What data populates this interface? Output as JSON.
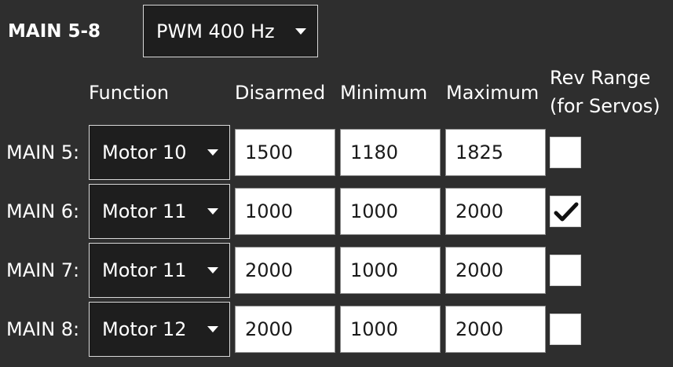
{
  "group": {
    "title": "MAIN 5-8",
    "pwm_rate": "PWM 400 Hz"
  },
  "columns": {
    "function": "Function",
    "disarmed": "Disarmed",
    "minimum": "Minimum",
    "maximum": "Maximum",
    "rev_range_line1": "Rev Range",
    "rev_range_line2": "(for Servos)"
  },
  "rows": [
    {
      "label": "MAIN 5:",
      "function": "Motor 10",
      "disarmed": "1500",
      "minimum": "1180",
      "maximum": "1825",
      "rev_range": false
    },
    {
      "label": "MAIN 6:",
      "function": "Motor 11",
      "disarmed": "1000",
      "minimum": "1000",
      "maximum": "2000",
      "rev_range": true
    },
    {
      "label": "MAIN 7:",
      "function": "Motor 11",
      "disarmed": "2000",
      "minimum": "1000",
      "maximum": "2000",
      "rev_range": false
    },
    {
      "label": "MAIN 8:",
      "function": "Motor 12",
      "disarmed": "2000",
      "minimum": "1000",
      "maximum": "2000",
      "rev_range": false
    }
  ],
  "colors": {
    "background": "#2e2e2e",
    "dropdown_background": "#1e1e1e",
    "input_background": "#ffffff"
  },
  "icons": {
    "dropdown": "caret-down-icon",
    "checked": "checkmark-icon"
  }
}
